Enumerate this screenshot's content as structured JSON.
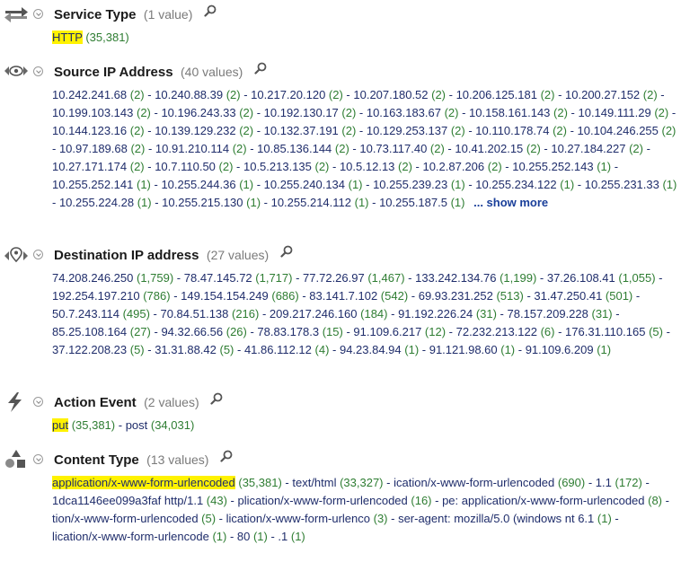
{
  "sections": [
    {
      "title": "Service Type",
      "count_label": "(1 value)",
      "icon": "arrows-exchange-icon",
      "values": [
        {
          "text": "HTTP",
          "count": "(35,381)",
          "highlight": true
        }
      ]
    },
    {
      "title": "Source IP Address",
      "count_label": "(40 values)",
      "icon": "source-ip-eye-icon",
      "show_more": "... show more",
      "values": [
        {
          "text": "10.242.241.68",
          "count": "(2)"
        },
        {
          "text": "10.240.88.39",
          "count": "(2)"
        },
        {
          "text": "10.217.20.120",
          "count": "(2)"
        },
        {
          "text": "10.207.180.52",
          "count": "(2)"
        },
        {
          "text": "10.206.125.181",
          "count": "(2)"
        },
        {
          "text": "10.200.27.152",
          "count": "(2)"
        },
        {
          "text": "10.199.103.143",
          "count": "(2)"
        },
        {
          "text": "10.196.243.33",
          "count": "(2)"
        },
        {
          "text": "10.192.130.17",
          "count": "(2)"
        },
        {
          "text": "10.163.183.67",
          "count": "(2)"
        },
        {
          "text": "10.158.161.143",
          "count": "(2)"
        },
        {
          "text": "10.149.111.29",
          "count": "(2)"
        },
        {
          "text": "10.144.123.16",
          "count": "(2)"
        },
        {
          "text": "10.139.129.232",
          "count": "(2)"
        },
        {
          "text": "10.132.37.191",
          "count": "(2)"
        },
        {
          "text": "10.129.253.137",
          "count": "(2)"
        },
        {
          "text": "10.110.178.74",
          "count": "(2)"
        },
        {
          "text": "10.104.246.255",
          "count": "(2)"
        },
        {
          "text": "10.97.189.68",
          "count": "(2)"
        },
        {
          "text": "10.91.210.114",
          "count": "(2)"
        },
        {
          "text": "10.85.136.144",
          "count": "(2)"
        },
        {
          "text": "10.73.117.40",
          "count": "(2)"
        },
        {
          "text": "10.41.202.15",
          "count": "(2)"
        },
        {
          "text": "10.27.184.227",
          "count": "(2)"
        },
        {
          "text": "10.27.171.174",
          "count": "(2)"
        },
        {
          "text": "10.7.110.50",
          "count": "(2)"
        },
        {
          "text": "10.5.213.135",
          "count": "(2)"
        },
        {
          "text": "10.5.12.13",
          "count": "(2)"
        },
        {
          "text": "10.2.87.206",
          "count": "(2)"
        },
        {
          "text": "10.255.252.143",
          "count": "(1)"
        },
        {
          "text": "10.255.252.141",
          "count": "(1)"
        },
        {
          "text": "10.255.244.36",
          "count": "(1)"
        },
        {
          "text": "10.255.240.134",
          "count": "(1)"
        },
        {
          "text": "10.255.239.23",
          "count": "(1)"
        },
        {
          "text": "10.255.234.122",
          "count": "(1)"
        },
        {
          "text": "10.255.231.33",
          "count": "(1)"
        },
        {
          "text": "10.255.224.28",
          "count": "(1)"
        },
        {
          "text": "10.255.215.130",
          "count": "(1)"
        },
        {
          "text": "10.255.214.112",
          "count": "(1)"
        },
        {
          "text": "10.255.187.5",
          "count": "(1)"
        }
      ]
    },
    {
      "title": "Destination IP address",
      "count_label": "(27 values)",
      "icon": "destination-ip-pin-icon",
      "values": [
        {
          "text": "74.208.246.250",
          "count": "(1,759)"
        },
        {
          "text": "78.47.145.72",
          "count": "(1,717)"
        },
        {
          "text": "77.72.26.97",
          "count": "(1,467)"
        },
        {
          "text": "133.242.134.76",
          "count": "(1,199)"
        },
        {
          "text": "37.26.108.41",
          "count": "(1,055)"
        },
        {
          "text": "192.254.197.210",
          "count": "(786)"
        },
        {
          "text": "149.154.154.249",
          "count": "(686)"
        },
        {
          "text": "83.141.7.102",
          "count": "(542)"
        },
        {
          "text": "69.93.231.252",
          "count": "(513)"
        },
        {
          "text": "31.47.250.41",
          "count": "(501)"
        },
        {
          "text": "50.7.243.114",
          "count": "(495)"
        },
        {
          "text": "70.84.51.138",
          "count": "(216)"
        },
        {
          "text": "209.217.246.160",
          "count": "(184)"
        },
        {
          "text": "91.192.226.24",
          "count": "(31)"
        },
        {
          "text": "78.157.209.228",
          "count": "(31)"
        },
        {
          "text": "85.25.108.164",
          "count": "(27)"
        },
        {
          "text": "94.32.66.56",
          "count": "(26)"
        },
        {
          "text": "78.83.178.3",
          "count": "(15)"
        },
        {
          "text": "91.109.6.217",
          "count": "(12)"
        },
        {
          "text": "72.232.213.122",
          "count": "(6)"
        },
        {
          "text": "176.31.110.165",
          "count": "(5)"
        },
        {
          "text": "37.122.208.23",
          "count": "(5)"
        },
        {
          "text": "31.31.88.42",
          "count": "(5)"
        },
        {
          "text": "41.86.112.12",
          "count": "(4)"
        },
        {
          "text": "94.23.84.94",
          "count": "(1)"
        },
        {
          "text": "91.121.98.60",
          "count": "(1)"
        },
        {
          "text": "91.109.6.209",
          "count": "(1)"
        }
      ]
    },
    {
      "title": "Action Event",
      "count_label": "(2 values)",
      "icon": "lightning-bolt-icon",
      "values": [
        {
          "text": "put",
          "count": "(35,381)",
          "highlight": true
        },
        {
          "text": "post",
          "count": "(34,031)"
        }
      ]
    },
    {
      "title": "Content Type",
      "count_label": "(13 values)",
      "icon": "shapes-icon",
      "values": [
        {
          "text": "application/x-www-form-urlencoded",
          "count": "(35,381)",
          "highlight": true
        },
        {
          "text": "text/html",
          "count": "(33,327)"
        },
        {
          "text": "ication/x-www-form-urlencoded",
          "count": "(690)"
        },
        {
          "text": "1.1",
          "count": "(172)"
        },
        {
          "text": "1dca1146ee099a3faf http/1.1",
          "count": "(43)"
        },
        {
          "text": "plication/x-www-form-urlencoded",
          "count": "(16)"
        },
        {
          "text": "pe: application/x-www-form-urlencoded",
          "count": "(8)"
        },
        {
          "text": "tion/x-www-form-urlencoded",
          "count": "(5)"
        },
        {
          "text": "lication/x-www-form-urlenco",
          "count": "(3)"
        },
        {
          "text": "ser-agent: mozilla/5.0 (windows nt 6.1",
          "count": "(1)"
        },
        {
          "text": "lication/x-www-form-urlencode",
          "count": "(1)"
        },
        {
          "text": "80",
          "count": "(1)"
        },
        {
          "text": ".1",
          "count": "(1)"
        }
      ]
    }
  ],
  "separator": "-",
  "colors": {
    "value_text": "#1f2d6b",
    "count_text": "#2e7d32",
    "highlight": "#fff200",
    "title": "#1a1a1a",
    "count_label": "#7a7a7a"
  }
}
